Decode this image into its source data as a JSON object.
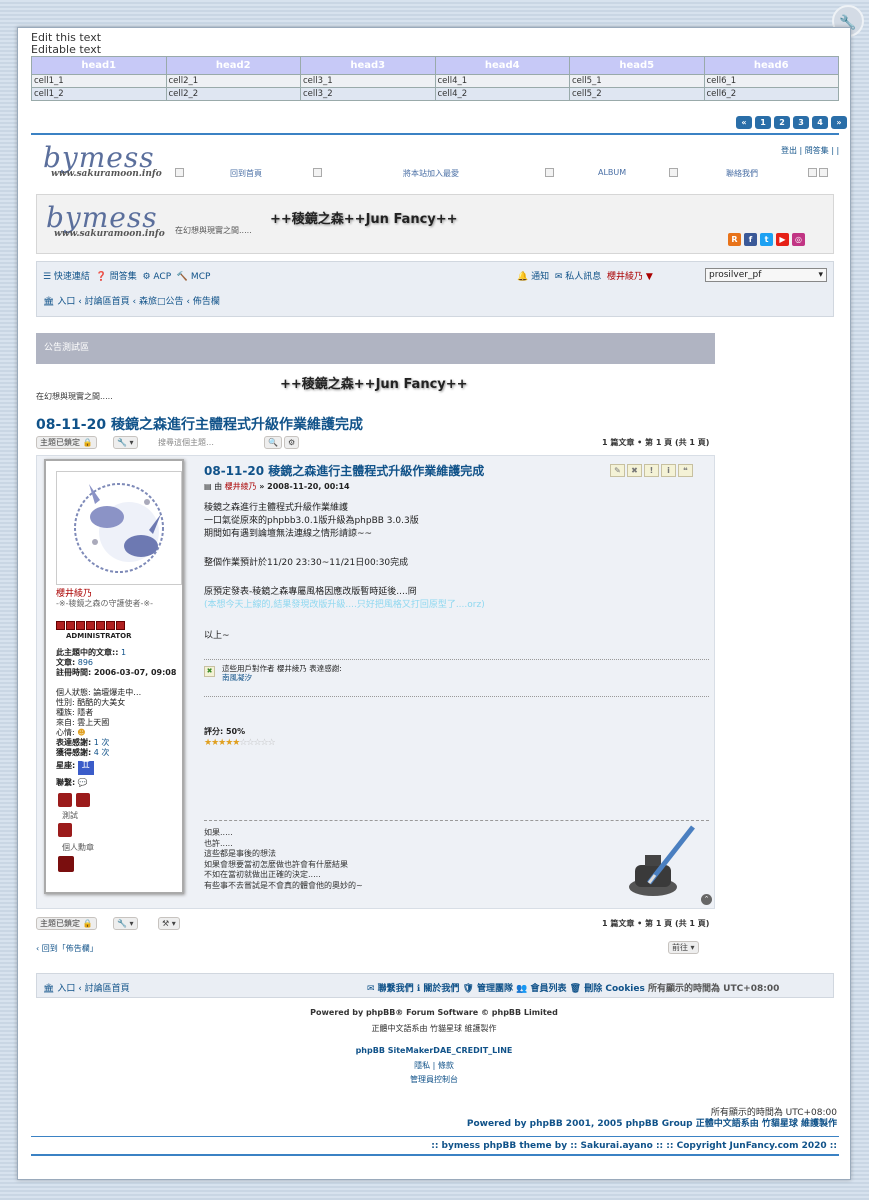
{
  "wrench_icon": "wrench-icon",
  "edit_title": "Edit this text",
  "edit_sub": "Editable text",
  "table": {
    "headers": [
      "head1",
      "head2",
      "head3",
      "head4",
      "head5",
      "head6"
    ],
    "rows": [
      [
        "cell1_1",
        "cell2_1",
        "cell3_1",
        "cell4_1",
        "cell5_1",
        "cell6_1"
      ],
      [
        "cell1_2",
        "cell2_2",
        "cell3_2",
        "cell4_2",
        "cell5_2",
        "cell6_2"
      ]
    ]
  },
  "pager": [
    "«",
    "1",
    "2",
    "3",
    "4",
    "»"
  ],
  "logo": {
    "big": "bymess",
    "small": "www.sakuramoon.info"
  },
  "topright": "登出 | 問答集 |  |",
  "topnav": [
    "回到首頁",
    "將本站加入最愛",
    "ALBUM",
    "聯絡我們"
  ],
  "header": {
    "tagline": "在幻想與現實之間.....",
    "title": "++稜鏡之森++Jun Fancy++"
  },
  "navbar": {
    "quicklinks": "☰ 快速連結",
    "faq": "❓ 問答集",
    "acp": "⚙ ACP",
    "mcp": "🔨 MCP",
    "notify": "🔔 通知",
    "pm": "✉ 私人訊息",
    "user": "櫻井綾乃 ▼",
    "style": "prosilver_pf",
    "crumbs": [
      "入口",
      "討論區首頁",
      "森旅□公告",
      "佈告欄"
    ]
  },
  "notice": "公告測試區",
  "site_title2": "++稜鏡之森++Jun Fancy++",
  "tagline2": "在幻想與現實之間.....",
  "topic_title": "08-11-20 稜鏡之森進行主體程式升級作業維護完成",
  "topic_tools": {
    "locked": "主題已鎖定 🔒",
    "wrench": "🔧 ▾",
    "search_ph": "搜尋這個主題…",
    "search": "🔍",
    "gear": "⚙"
  },
  "pages": "1 篇文章 • 第 1 頁 (共 1 頁)",
  "post": {
    "title": "08-11-20 稜鏡之森進行主體程式升級作業維護完成",
    "meta_prefix": "由",
    "author": "櫻井綾乃",
    "meta_date": "» 2008-11-20, 00:14",
    "lines": [
      "稜鏡之森進行主體程式升級作業維護",
      "一口氣從原來的phpbb3.0.1版升級為phpBB 3.0.3版",
      "期間如有遇到論壇無法連線之情形請諒~~"
    ],
    "line2": "整個作業預計於11/20 23:30~11/21日00:30完成",
    "line3": "原預定發表-稜鏡之森專屬風格因應改版暫時延後....冏",
    "line4": "(本想今天上線的,結果發現改版升級....只好把風格又打回原型了....orz)",
    "line5": "以上~",
    "thanks_label": "這些用戶對作者 櫻井綾乃 表達感謝:",
    "thanks_user": "南風凝汐",
    "rating": "評分: 50%",
    "signature": [
      "如果.....",
      "也許.....",
      "這些都是事後的想法",
      "如果會想要當初怎麼做也許會有什麼結果",
      "不如在當初就做出正確的決定.....",
      "有些事不去嘗試是不會真的體會他的奧妙的~"
    ]
  },
  "profile": {
    "name": "櫻井綾乃",
    "title": "-※-稜鏡之森の守護使者-※-",
    "rank": "ADMINISTRATOR",
    "topic_posts_label": "此主題中的文章::",
    "topic_posts": "1",
    "posts_label": "文章:",
    "posts": "896",
    "joined": "註冊時間: 2006-03-07, 09:08",
    "status": "個人狀態: 論壇爆走中…",
    "gender": "性別: 酷酷的大美女",
    "race": "種族: 隱者",
    "from": "來自: 雲上天國",
    "mood": "心情:",
    "thanked_label": "表達感謝:",
    "thanked": "1 次",
    "got_thanks_label": "獲得感謝:",
    "got_thanks": "4 次",
    "zodiac": "星座:",
    "contact": "聯繫:",
    "test": "測試",
    "medal": "個人勳章"
  },
  "back": "‹ 回到「佈告欄」",
  "jump": "前往  ▾",
  "footer": {
    "crumbs": [
      "入口",
      "討論區首頁"
    ],
    "links": "✉ 聯繫我們  ℹ 關於我們  🛡 管理團隊  👥 會員列表  🗑 刪除 Cookies",
    "tz": "所有顯示的時間為 UTC+08:00"
  },
  "powered": [
    "Powered by phpBB® Forum Software © phpBB Limited",
    "正體中文語系由 竹貓星球 維護製作",
    "phpBB SiteMakerDAE_CREDIT_LINE",
    "隱私 | 條款",
    "管理員控制台"
  ],
  "bottom_tz": "所有顯示的時間為 UTC+08:00",
  "bottom_powered": "Powered by phpBB 2001, 2005 phpBB Group 正體中文語系由 竹貓星球 維護製作",
  "bottom_theme": ":: bymess phpBB theme by :: Sakurai.ayano :: :: Copyright JunFancy.com 2020 ::"
}
